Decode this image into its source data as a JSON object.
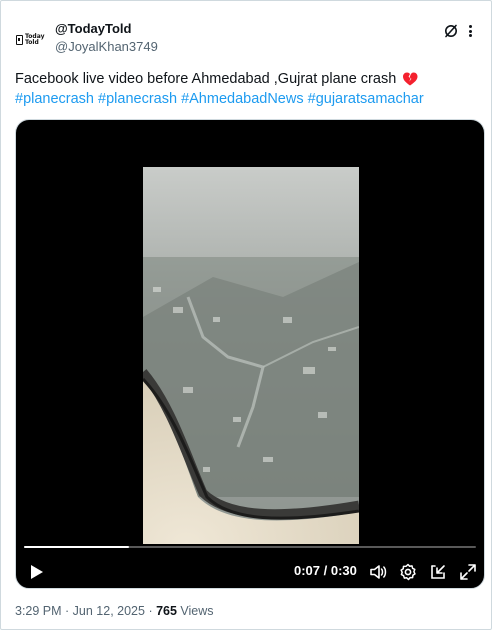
{
  "author": {
    "display_name": "@TodayTold",
    "handle": "@JoyalKhan3749",
    "avatar_text_top": "Today",
    "avatar_text_bottom": "Told"
  },
  "tweet": {
    "text_main": "Facebook live video before Ahmedabad ,Gujrat   plane crash",
    "emoji": "broken-heart-icon",
    "hashtags": [
      "#planecrash",
      "#planecrash",
      "#AhmedabadNews",
      "#gujaratsamachar"
    ]
  },
  "video": {
    "elapsed": "0:07",
    "separator": " / ",
    "duration": "0:30",
    "progress_fraction": 0.233
  },
  "meta": {
    "time": "3:29 PM",
    "sep1": " · ",
    "date": "Jun 12, 2025",
    "sep2": " · ",
    "views_count": "765",
    "views_label": " Views"
  },
  "icons": {
    "header_action": "grok-icon",
    "header_menu": "more-icon",
    "play": "play-icon",
    "volume": "volume-icon",
    "settings": "settings-icon",
    "pip": "picture-in-picture-icon",
    "fullscreen": "fullscreen-icon"
  },
  "colors": {
    "text": "#0f1419",
    "secondary": "#536471",
    "link": "#1d9bf0",
    "video_bg": "#000000",
    "heart": "#f4212e"
  }
}
